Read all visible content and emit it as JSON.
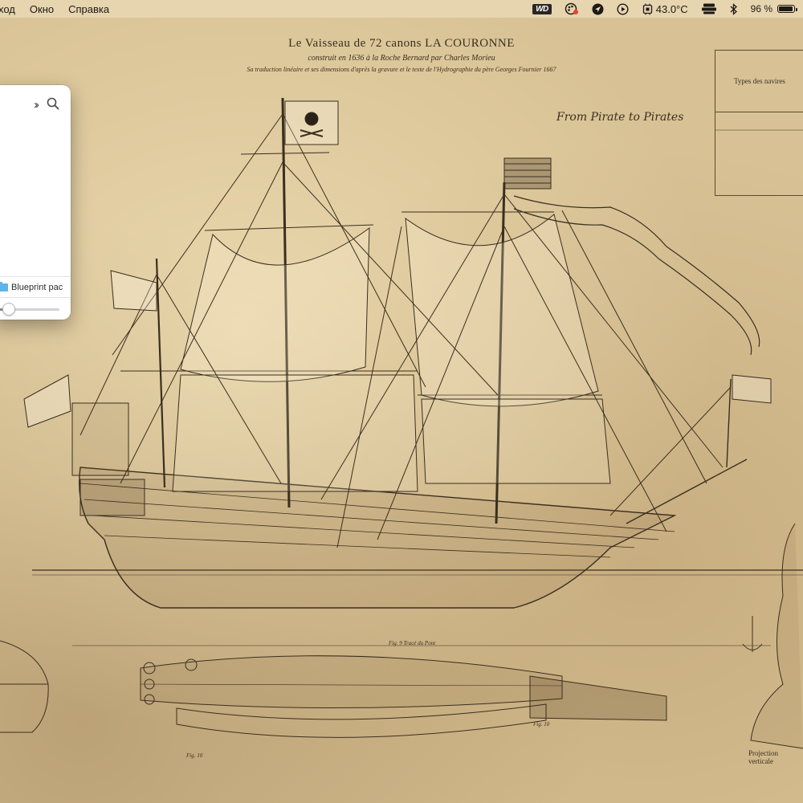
{
  "menubar": {
    "items": [
      "ход",
      "Окно",
      "Справка"
    ],
    "status": {
      "wd_label": "WD",
      "temperature": "43.0°C",
      "battery_text": "96 %",
      "battery_level": 0.96
    }
  },
  "wallpaper": {
    "title": "Le Vaisseau de 72 canons LA COURONNE",
    "subtitle": "construit en 1636 à la Roche Bernard par Charles Morieu",
    "caption": "Sa traduction linéaire et ses dimensions d'après la gravure et le texte de l'Hydrographie du père Georges Fournier 1667",
    "script_text": "From Pirate to Pirates",
    "table_header": "Types des navires",
    "fig_labels": [
      "Fig. 9 Tracé du Pont",
      "Fig. 10",
      "Fig. 10"
    ],
    "projection_label": "Projection verticale"
  },
  "finder": {
    "path_label": "Blueprint pac",
    "zoom_level": 0.2
  },
  "colors": {
    "accent_folder": "#5fb3e8",
    "paper": "#d8c295",
    "ink": "#3a2f1f"
  }
}
